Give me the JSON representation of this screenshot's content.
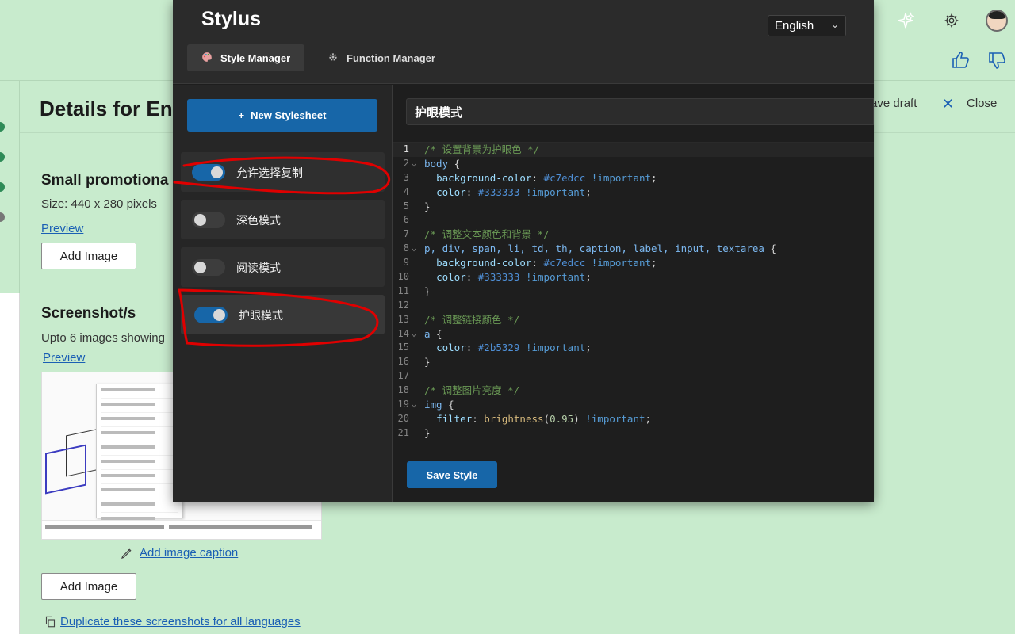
{
  "background_page": {
    "title": "Details for En",
    "save_draft": "ave draft",
    "close": "Close",
    "promo": {
      "title": "Small promotiona",
      "size": "Size: 440 x 280 pixels",
      "preview": "Preview",
      "add_image": "Add Image"
    },
    "screenshots": {
      "title": "Screenshot/s",
      "desc": "Upto 6 images showing",
      "preview": "Preview",
      "add_caption": "Add image caption",
      "add_image": "Add Image",
      "duplicate": "Duplicate these screenshots for all languages"
    }
  },
  "popup": {
    "app_title": "Stylus",
    "language": "English",
    "tabs": [
      {
        "label": "Style Manager",
        "active": true
      },
      {
        "label": "Function Manager",
        "active": false
      }
    ],
    "new_stylesheet": "New Stylesheet",
    "styles": [
      {
        "label": "允许选择复制",
        "enabled": true
      },
      {
        "label": "深色模式",
        "enabled": false
      },
      {
        "label": "阅读模式",
        "enabled": false
      },
      {
        "label": "护眼模式",
        "enabled": true
      }
    ],
    "current_style_name": "护眼模式",
    "save_button": "Save Style",
    "code_lines": [
      "/* 设置背景为护眼色 */",
      "body {",
      "  background-color: #c7edcc !important;",
      "  color: #333333 !important;",
      "}",
      "",
      "/* 调整文本颜色和背景 */",
      "p, div, span, li, td, th, caption, label, input, textarea {",
      "  background-color: #c7edcc !important;",
      "  color: #333333 !important;",
      "}",
      "",
      "/* 调整链接颜色 */",
      "a {",
      "  color: #2b5329 !important;",
      "}",
      "",
      "/* 调整图片亮度 */",
      "img {",
      "  filter: brightness(0.95) !important;",
      "}"
    ]
  },
  "colors": {
    "page_bg": "#c8ebcd",
    "accent": "#1766a8",
    "annotation": "#e00000"
  },
  "icons": {
    "top_bar": [
      "sparkle-icon",
      "gear-icon",
      "avatar"
    ],
    "feedback": [
      "thumbs-up-icon",
      "thumbs-down-icon"
    ]
  }
}
